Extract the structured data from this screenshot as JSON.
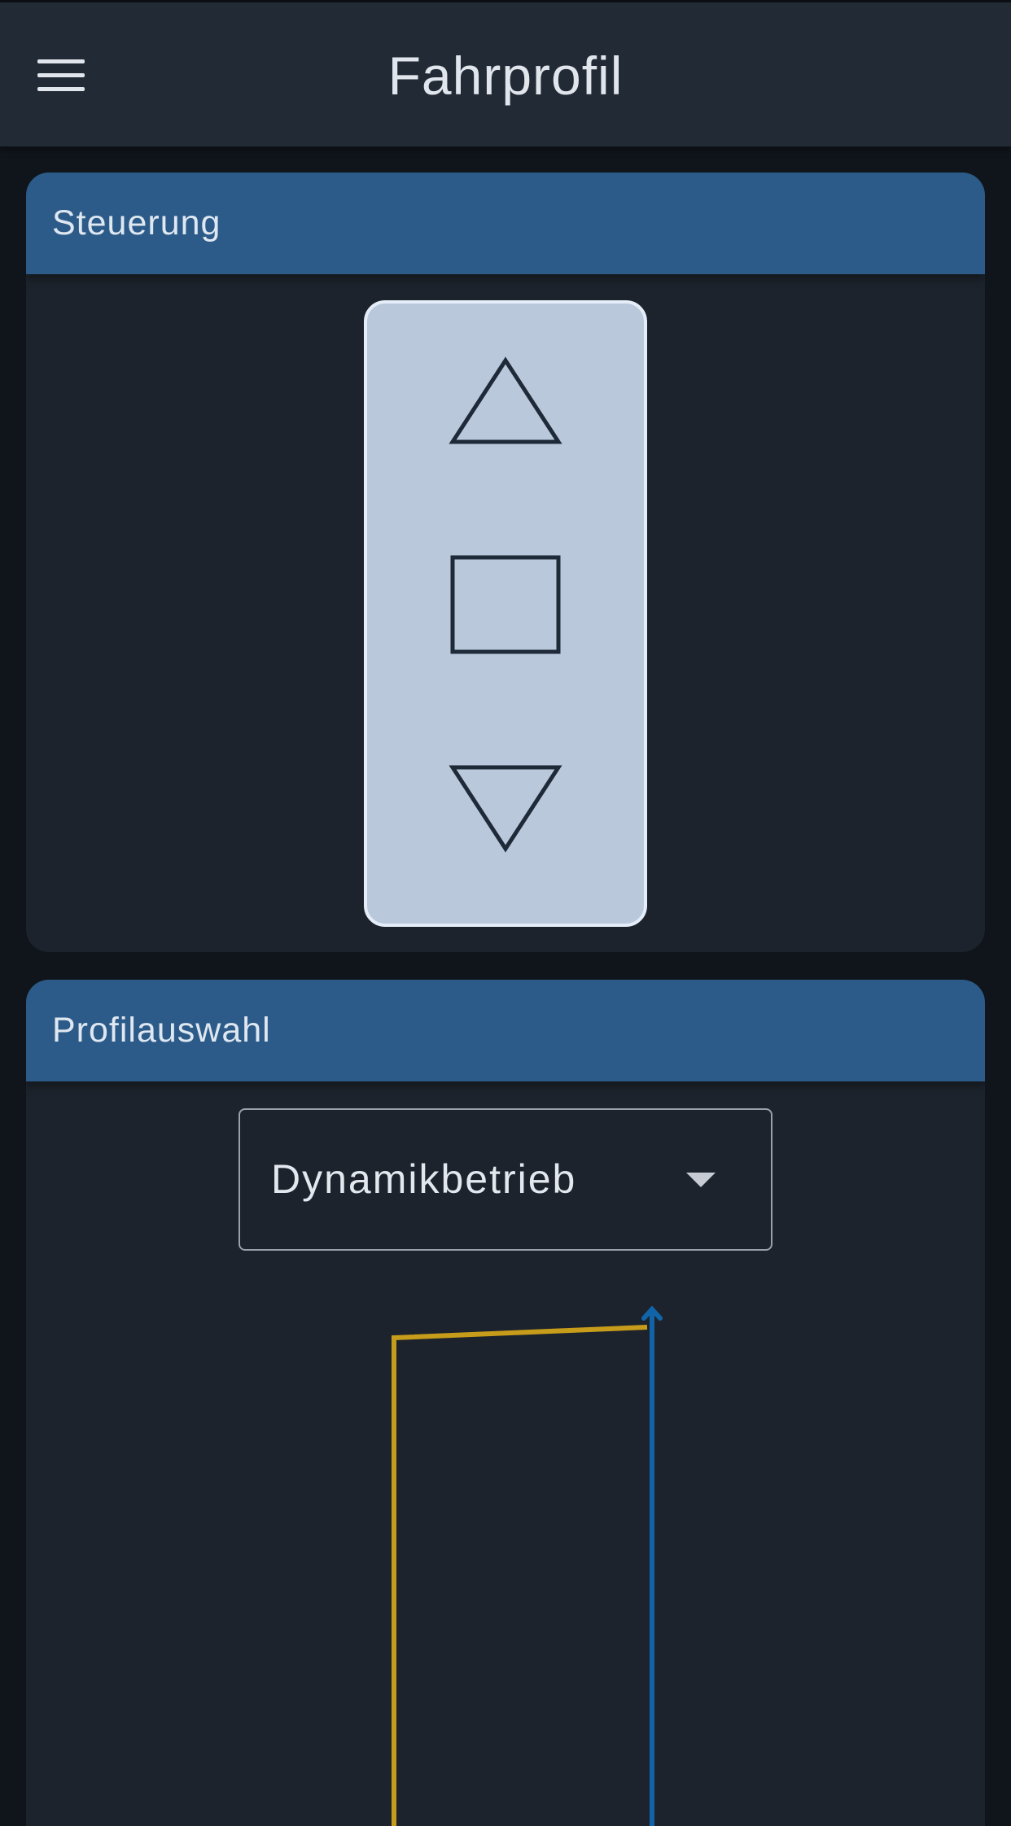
{
  "app_bar": {
    "title": "Fahrprofil",
    "menu_icon": "hamburger-menu-icon"
  },
  "steuerung": {
    "title": "Steuerung",
    "buttons": {
      "up_icon": "triangle-up-icon",
      "stop_icon": "square-stop-icon",
      "down_icon": "triangle-down-icon"
    },
    "pad_color": "#bac8dc"
  },
  "profilauswahl": {
    "title": "Profilauswahl",
    "select": {
      "value": "Dynamikbetrieb",
      "icon": "dropdown-arrow-icon"
    },
    "graph_colors": {
      "yellow_line": "#c79c1a",
      "blue_line": "#1264a8"
    }
  },
  "colors": {
    "header_bg": "#222a35",
    "card_header": "#2c5b89",
    "card_bg": "#1d232c",
    "page_bg": "#10151b"
  }
}
